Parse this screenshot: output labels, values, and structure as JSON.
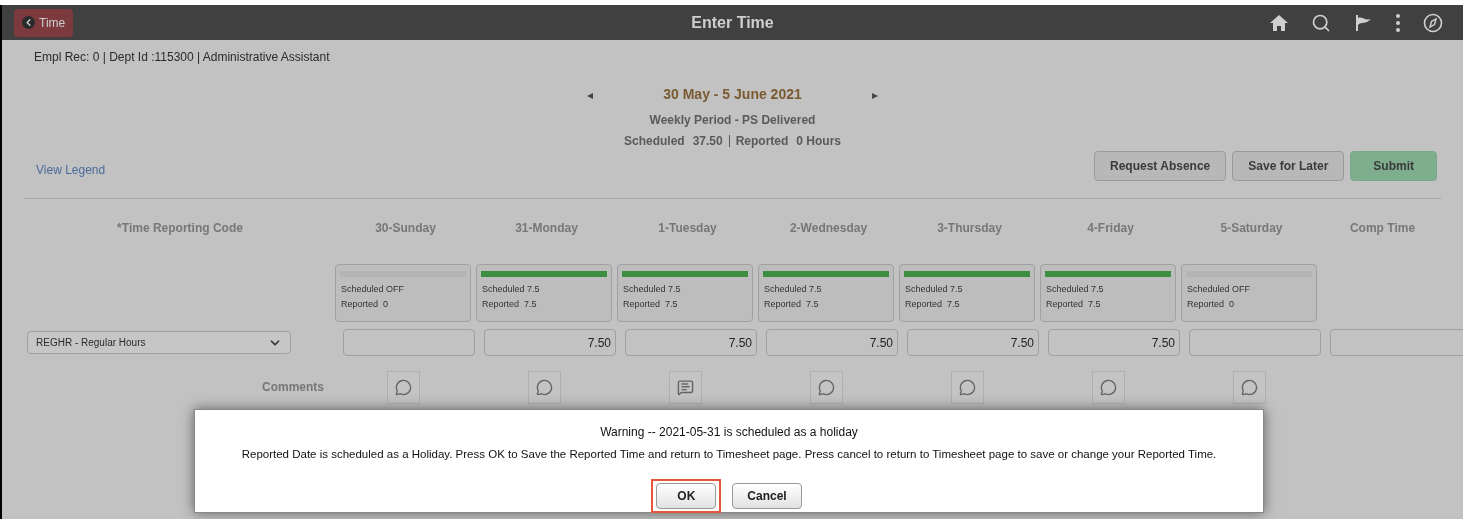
{
  "header": {
    "back_label": "Time",
    "title": "Enter Time"
  },
  "employee_info": "Empl Rec: 0 | Dept Id :115300 | Administrative Assistant",
  "period": {
    "prev": "◂",
    "range": "30 May - 5 June 2021",
    "next": "▸",
    "type": "Weekly Period - PS Delivered",
    "scheduled_label": "Scheduled",
    "scheduled_value": "37.50",
    "reported_label": "Reported",
    "reported_value": "0 Hours"
  },
  "legend_link": "View Legend",
  "actions": [
    {
      "label": "Request Absence",
      "primary": false
    },
    {
      "label": "Save for Later",
      "primary": false
    },
    {
      "label": "Submit",
      "primary": true
    }
  ],
  "trc_heading": "*Time Reporting Code",
  "trc_select": {
    "value": "REGHR - Regular Hours"
  },
  "comments_label": "Comments",
  "days": [
    {
      "label": "30-Sunday",
      "scheduled": false,
      "scheduled_text": "Scheduled OFF",
      "reported_text": "Reported  0",
      "has_comment": false
    },
    {
      "label": "31-Monday",
      "scheduled": true,
      "scheduled_text": "Scheduled 7.5",
      "reported_text": "Reported  7.5",
      "value": "7.50",
      "has_comment": false
    },
    {
      "label": "1-Tuesday",
      "scheduled": true,
      "scheduled_text": "Scheduled 7.5",
      "reported_text": "Reported  7.5",
      "value": "7.50",
      "has_comment": true
    },
    {
      "label": "2-Wednesday",
      "scheduled": true,
      "scheduled_text": "Scheduled 7.5",
      "reported_text": "Reported  7.5",
      "value": "7.50",
      "has_comment": false
    },
    {
      "label": "3-Thursday",
      "scheduled": true,
      "scheduled_text": "Scheduled 7.5",
      "reported_text": "Reported  7.5",
      "value": "7.50",
      "has_comment": false
    },
    {
      "label": "4-Friday",
      "scheduled": true,
      "scheduled_text": "Scheduled 7.5",
      "reported_text": "Reported  7.5",
      "value": "7.50",
      "has_comment": false
    },
    {
      "label": "5-Saturday",
      "scheduled": false,
      "scheduled_text": "Scheduled OFF",
      "reported_text": "Reported  0",
      "has_comment": false
    }
  ],
  "comp_time": {
    "label": "Comp Time"
  },
  "dialog": {
    "title": "Warning -- 2021-05-31 is scheduled as  a holiday",
    "message": "Reported Date is scheduled as a Holiday. Press OK to Save the Reported Time and return to Timesheet page. Press cancel to return to Timesheet page to save or change your Reported Time.",
    "buttons": [
      {
        "label": "OK",
        "highlighted": true
      },
      {
        "label": "Cancel",
        "highlighted": false
      }
    ]
  }
}
